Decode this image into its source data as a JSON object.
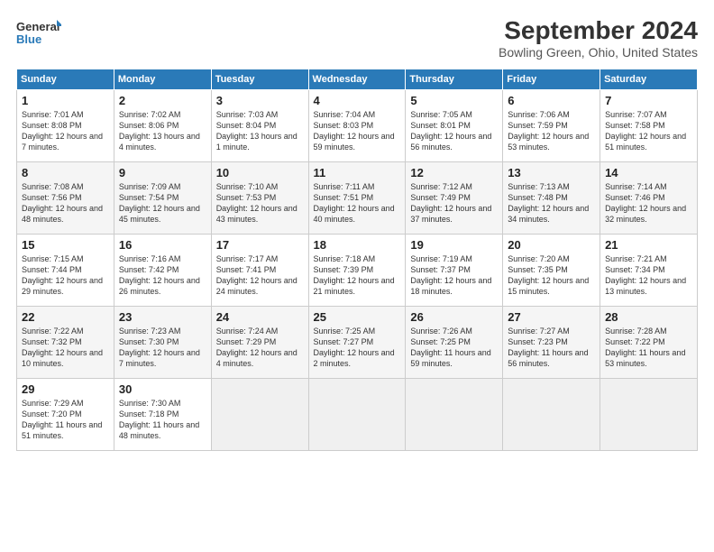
{
  "header": {
    "logo_line1": "General",
    "logo_line2": "Blue",
    "title": "September 2024",
    "subtitle": "Bowling Green, Ohio, United States"
  },
  "days_of_week": [
    "Sunday",
    "Monday",
    "Tuesday",
    "Wednesday",
    "Thursday",
    "Friday",
    "Saturday"
  ],
  "weeks": [
    [
      {
        "day": 1,
        "sunrise": "7:01 AM",
        "sunset": "8:08 PM",
        "daylight": "12 hours and 7 minutes."
      },
      {
        "day": 2,
        "sunrise": "7:02 AM",
        "sunset": "8:06 PM",
        "daylight": "13 hours and 4 minutes."
      },
      {
        "day": 3,
        "sunrise": "7:03 AM",
        "sunset": "8:04 PM",
        "daylight": "13 hours and 1 minute."
      },
      {
        "day": 4,
        "sunrise": "7:04 AM",
        "sunset": "8:03 PM",
        "daylight": "12 hours and 59 minutes."
      },
      {
        "day": 5,
        "sunrise": "7:05 AM",
        "sunset": "8:01 PM",
        "daylight": "12 hours and 56 minutes."
      },
      {
        "day": 6,
        "sunrise": "7:06 AM",
        "sunset": "7:59 PM",
        "daylight": "12 hours and 53 minutes."
      },
      {
        "day": 7,
        "sunrise": "7:07 AM",
        "sunset": "7:58 PM",
        "daylight": "12 hours and 51 minutes."
      }
    ],
    [
      {
        "day": 8,
        "sunrise": "7:08 AM",
        "sunset": "7:56 PM",
        "daylight": "12 hours and 48 minutes."
      },
      {
        "day": 9,
        "sunrise": "7:09 AM",
        "sunset": "7:54 PM",
        "daylight": "12 hours and 45 minutes."
      },
      {
        "day": 10,
        "sunrise": "7:10 AM",
        "sunset": "7:53 PM",
        "daylight": "12 hours and 43 minutes."
      },
      {
        "day": 11,
        "sunrise": "7:11 AM",
        "sunset": "7:51 PM",
        "daylight": "12 hours and 40 minutes."
      },
      {
        "day": 12,
        "sunrise": "7:12 AM",
        "sunset": "7:49 PM",
        "daylight": "12 hours and 37 minutes."
      },
      {
        "day": 13,
        "sunrise": "7:13 AM",
        "sunset": "7:48 PM",
        "daylight": "12 hours and 34 minutes."
      },
      {
        "day": 14,
        "sunrise": "7:14 AM",
        "sunset": "7:46 PM",
        "daylight": "12 hours and 32 minutes."
      }
    ],
    [
      {
        "day": 15,
        "sunrise": "7:15 AM",
        "sunset": "7:44 PM",
        "daylight": "12 hours and 29 minutes."
      },
      {
        "day": 16,
        "sunrise": "7:16 AM",
        "sunset": "7:42 PM",
        "daylight": "12 hours and 26 minutes."
      },
      {
        "day": 17,
        "sunrise": "7:17 AM",
        "sunset": "7:41 PM",
        "daylight": "12 hours and 24 minutes."
      },
      {
        "day": 18,
        "sunrise": "7:18 AM",
        "sunset": "7:39 PM",
        "daylight": "12 hours and 21 minutes."
      },
      {
        "day": 19,
        "sunrise": "7:19 AM",
        "sunset": "7:37 PM",
        "daylight": "12 hours and 18 minutes."
      },
      {
        "day": 20,
        "sunrise": "7:20 AM",
        "sunset": "7:35 PM",
        "daylight": "12 hours and 15 minutes."
      },
      {
        "day": 21,
        "sunrise": "7:21 AM",
        "sunset": "7:34 PM",
        "daylight": "12 hours and 13 minutes."
      }
    ],
    [
      {
        "day": 22,
        "sunrise": "7:22 AM",
        "sunset": "7:32 PM",
        "daylight": "12 hours and 10 minutes."
      },
      {
        "day": 23,
        "sunrise": "7:23 AM",
        "sunset": "7:30 PM",
        "daylight": "12 hours and 7 minutes."
      },
      {
        "day": 24,
        "sunrise": "7:24 AM",
        "sunset": "7:29 PM",
        "daylight": "12 hours and 4 minutes."
      },
      {
        "day": 25,
        "sunrise": "7:25 AM",
        "sunset": "7:27 PM",
        "daylight": "12 hours and 2 minutes."
      },
      {
        "day": 26,
        "sunrise": "7:26 AM",
        "sunset": "7:25 PM",
        "daylight": "11 hours and 59 minutes."
      },
      {
        "day": 27,
        "sunrise": "7:27 AM",
        "sunset": "7:23 PM",
        "daylight": "11 hours and 56 minutes."
      },
      {
        "day": 28,
        "sunrise": "7:28 AM",
        "sunset": "7:22 PM",
        "daylight": "11 hours and 53 minutes."
      }
    ],
    [
      {
        "day": 29,
        "sunrise": "7:29 AM",
        "sunset": "7:20 PM",
        "daylight": "11 hours and 51 minutes."
      },
      {
        "day": 30,
        "sunrise": "7:30 AM",
        "sunset": "7:18 PM",
        "daylight": "11 hours and 48 minutes."
      },
      null,
      null,
      null,
      null,
      null
    ]
  ]
}
